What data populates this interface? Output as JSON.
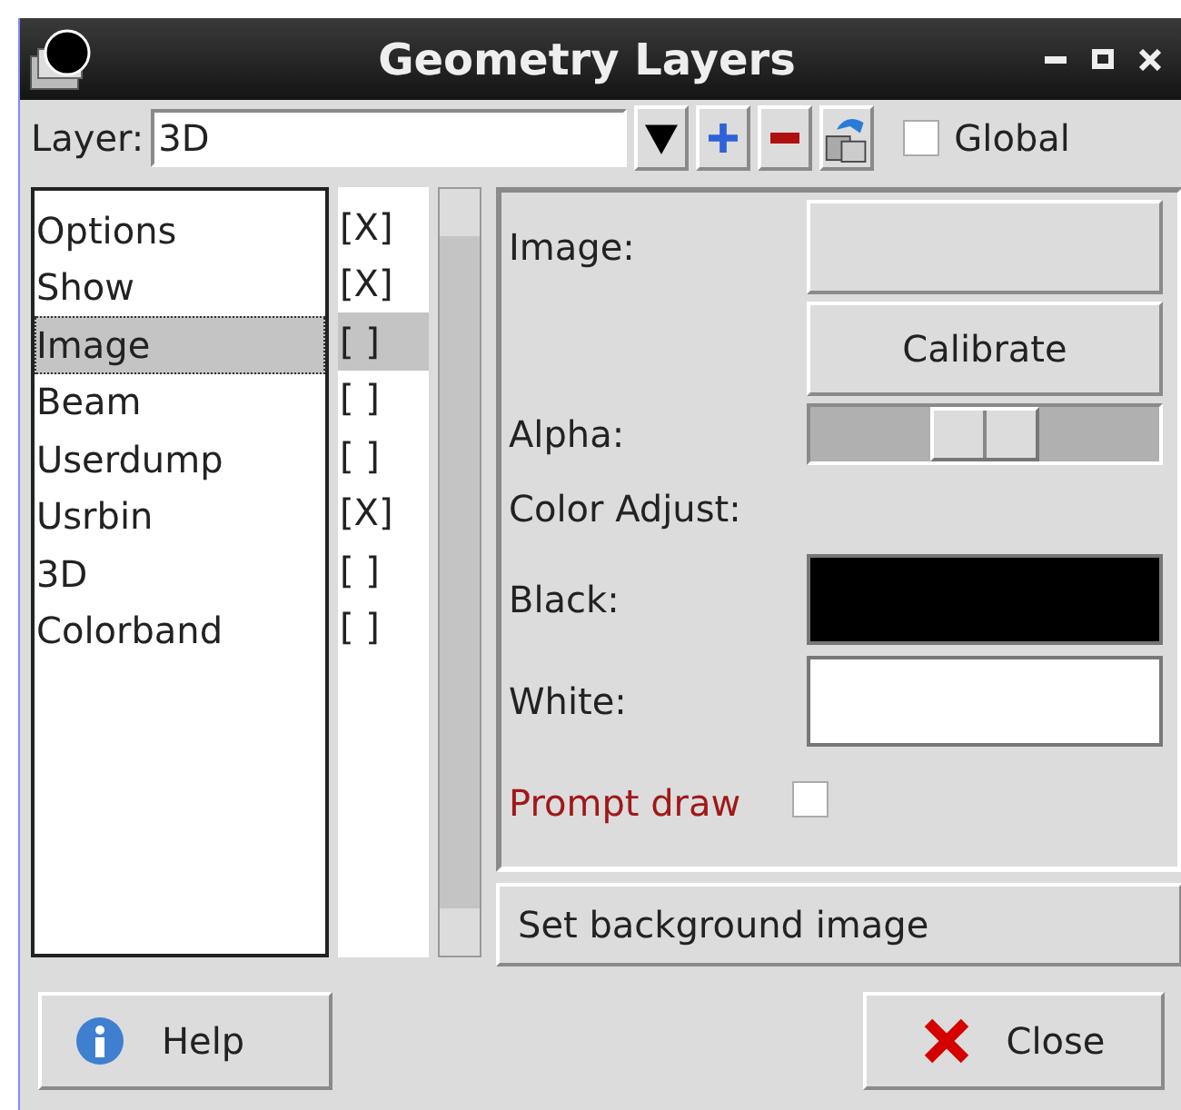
{
  "window": {
    "title": "Geometry Layers"
  },
  "toolbar": {
    "label": "Layer:",
    "layer": "3D",
    "global": {
      "label": "Global",
      "checked": false
    }
  },
  "layers": [
    {
      "name": "Options",
      "flag": "[X]",
      "selected": false
    },
    {
      "name": "Show",
      "flag": "[X]",
      "selected": false
    },
    {
      "name": "Image",
      "flag": "[ ]",
      "selected": true
    },
    {
      "name": "Beam",
      "flag": "[ ]",
      "selected": false
    },
    {
      "name": "Userdump",
      "flag": "[ ]",
      "selected": false
    },
    {
      "name": "Usrbin",
      "flag": "[X]",
      "selected": false
    },
    {
      "name": "3D",
      "flag": "[ ]",
      "selected": false
    },
    {
      "name": "Colorband",
      "flag": "[ ]",
      "selected": false
    }
  ],
  "panel": {
    "image_label": "Image:",
    "calibrate": "Calibrate",
    "alpha": {
      "label": "Alpha:",
      "level": 0.5
    },
    "color_adjust": "Color Adjust:",
    "black": {
      "label": "Black:",
      "color": "#000000"
    },
    "white": {
      "label": "White:",
      "color": "#ffffff"
    },
    "prompt_draw": {
      "label": "Prompt draw",
      "checked": false
    }
  },
  "set_background": "Set background image",
  "buttons": {
    "help": "Help",
    "close": "Close"
  }
}
